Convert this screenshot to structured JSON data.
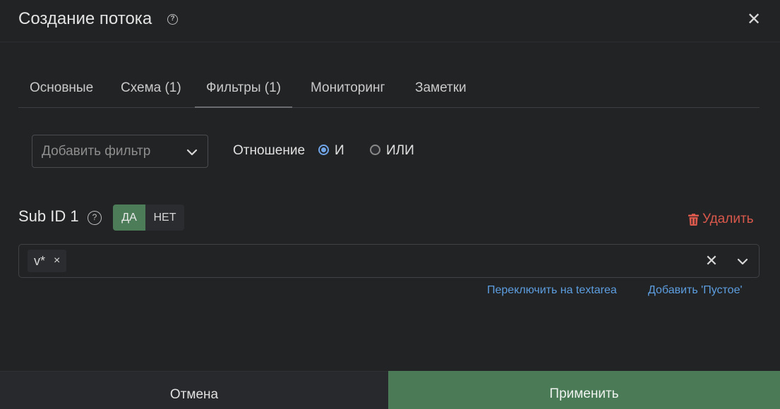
{
  "header": {
    "title": "Создание потока",
    "help_glyph": "?",
    "close_glyph": "✕"
  },
  "tabs": [
    {
      "label": "Основные",
      "active": false
    },
    {
      "label": "Схема (1)",
      "active": false
    },
    {
      "label": "Фильтры (1)",
      "active": true
    },
    {
      "label": "Мониторинг",
      "active": false
    },
    {
      "label": "Заметки",
      "active": false
    }
  ],
  "filters": {
    "add_filter_placeholder": "Добавить фильтр",
    "relation_label": "Отношение",
    "relation_options": [
      {
        "label": "И",
        "selected": true
      },
      {
        "label": "ИЛИ",
        "selected": false
      }
    ]
  },
  "subid": {
    "title": "Sub ID 1",
    "help_glyph": "?",
    "toggle_yes": "ДА",
    "toggle_no": "НЕТ",
    "toggle_selected": "ДА",
    "delete_label": "Удалить",
    "chips": [
      {
        "value": "v*"
      }
    ],
    "chip_remove_glyph": "×",
    "clear_glyph": "✕",
    "switch_link": "Переключить на textarea",
    "add_empty_link": "Добавить 'Пустое'"
  },
  "footer": {
    "cancel_label": "Отмена",
    "apply_label": "Применить"
  },
  "colors": {
    "background": "#222325",
    "accent_green": "#4a7b56",
    "link_blue": "#5d9ee0",
    "danger_red": "#d9584c",
    "radio_blue": "#6fa4e6"
  }
}
